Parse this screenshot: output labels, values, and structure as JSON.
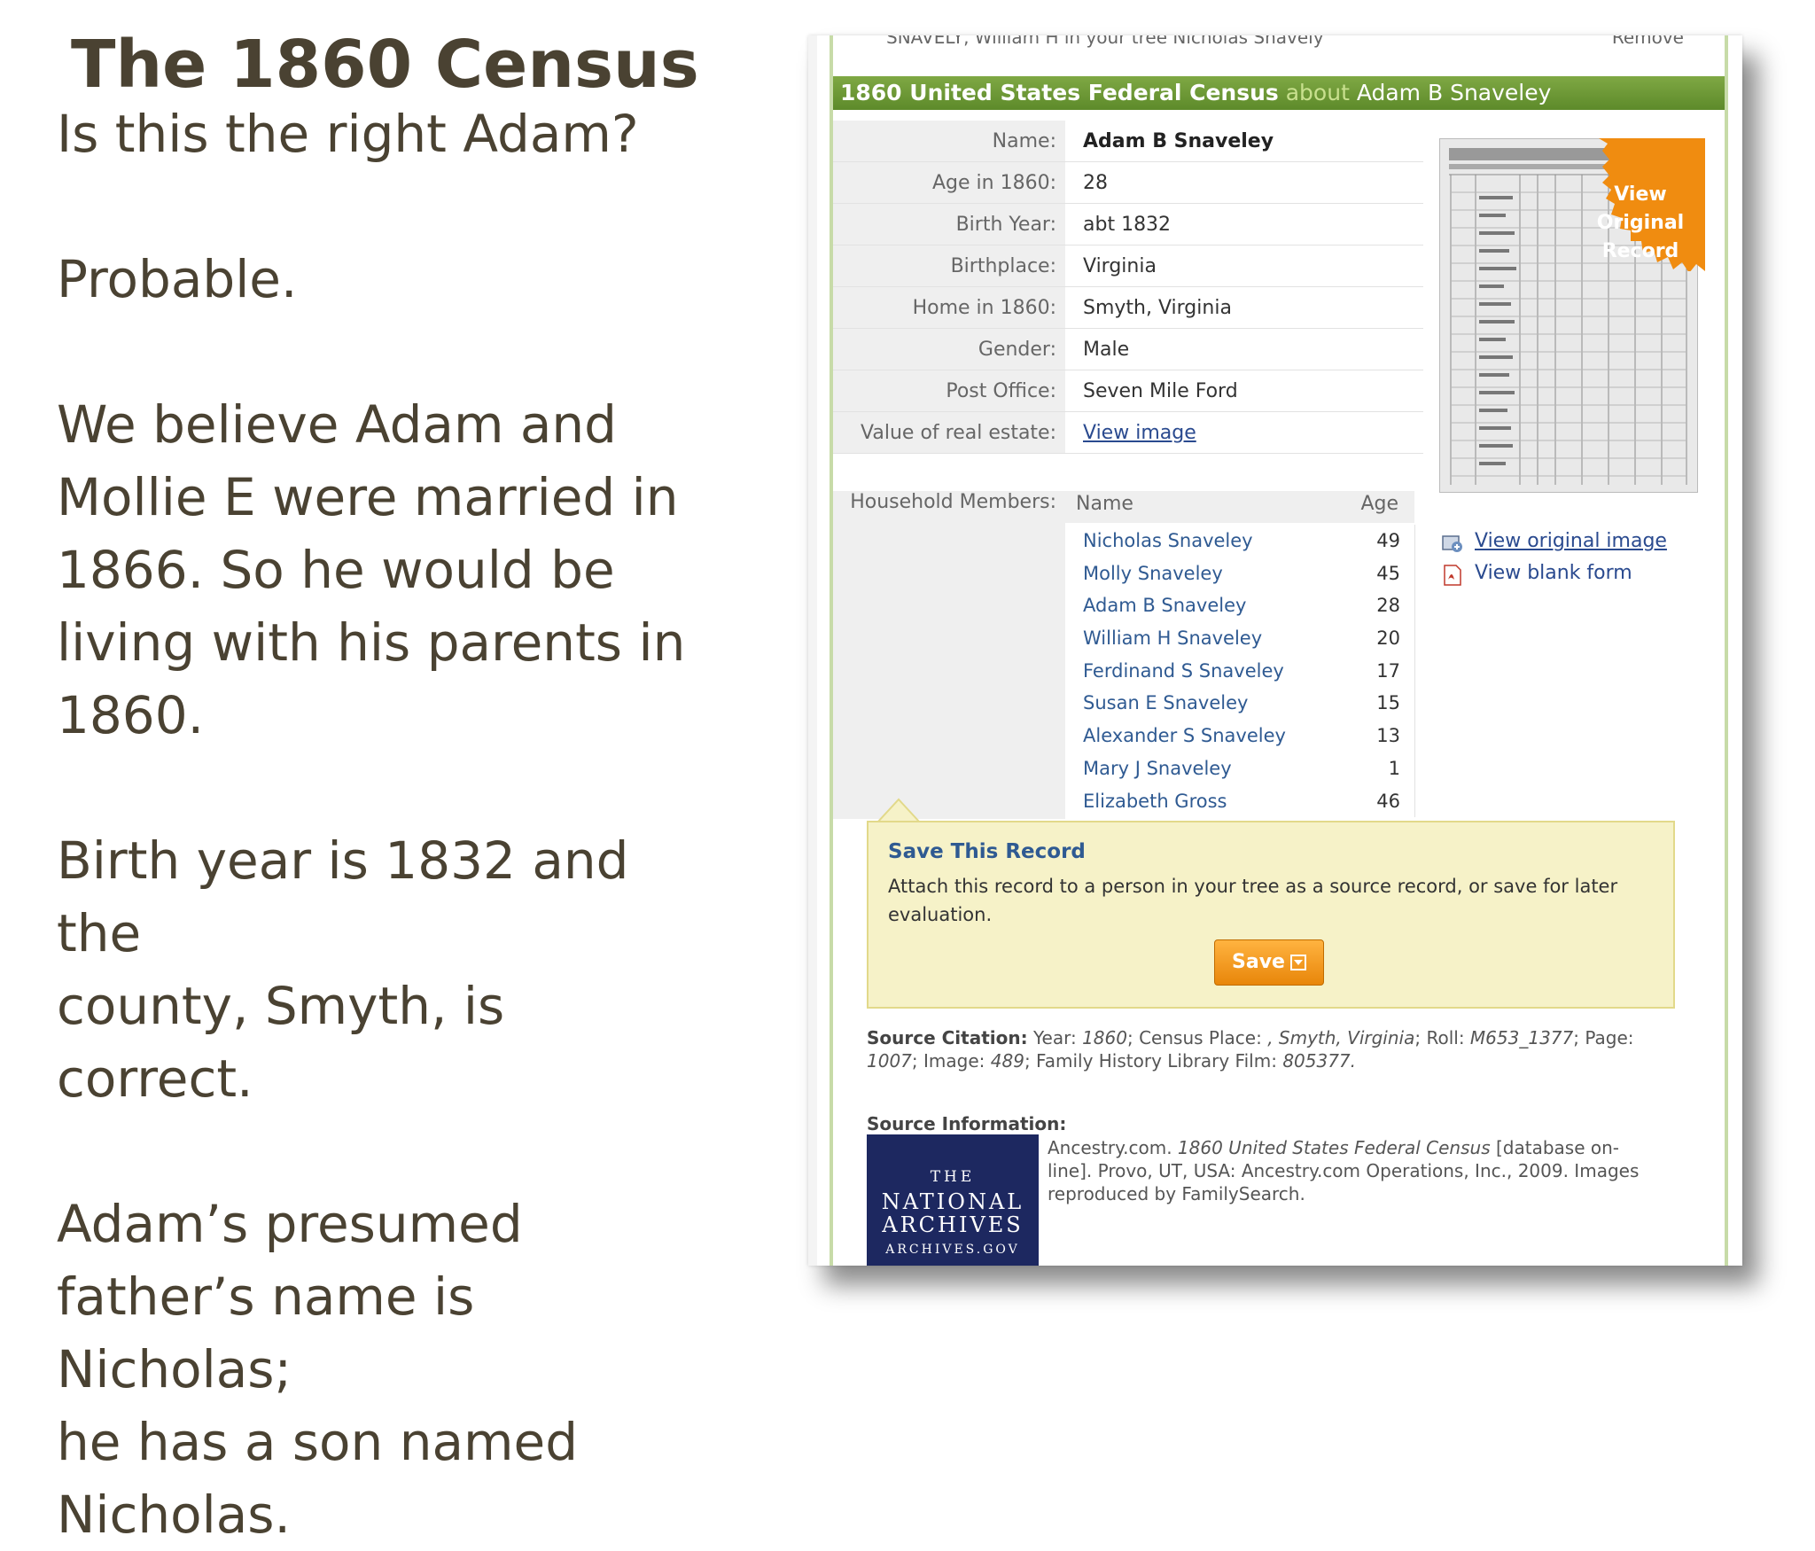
{
  "slide": {
    "title": "The 1860 Census",
    "question": "Is this the right Adam?",
    "answer": "Probable.",
    "para1": [
      "We believe Adam and",
      "Mollie E were married in",
      "1866.  So he would be",
      "living with his parents in",
      "1860."
    ],
    "para2": [
      "Birth year is 1832 and the",
      "county, Smyth, is correct."
    ],
    "para3": [
      "Adam’s presumed",
      "father’s name is Nicholas;",
      "he has a son named",
      "Nicholas."
    ]
  },
  "top_strip": {
    "text": "SNAVELY, William H in your tree   Nicholas Snavely",
    "remove": "Remove"
  },
  "record_header": {
    "title": "1860 United States Federal Census",
    "about": "about",
    "person": "Adam B Snaveley"
  },
  "fields": [
    {
      "label": "Name:",
      "value": "Adam B Snaveley"
    },
    {
      "label": "Age in 1860:",
      "value": "28"
    },
    {
      "label": "Birth Year:",
      "value": "abt 1832"
    },
    {
      "label": "Birthplace:",
      "value": "Virginia"
    },
    {
      "label": "Home in 1860:",
      "value": "Smyth, Virginia"
    },
    {
      "label": "Gender:",
      "value": "Male"
    },
    {
      "label": "Post Office:",
      "value": "Seven Mile Ford"
    },
    {
      "label": "Value of real estate:",
      "value": "View image"
    }
  ],
  "household": {
    "label": "Household Members:",
    "col_name": "Name",
    "col_age": "Age",
    "members": [
      {
        "name": "Nicholas Snaveley",
        "age": "49"
      },
      {
        "name": "Molly Snaveley",
        "age": "45"
      },
      {
        "name": "Adam B Snaveley",
        "age": "28"
      },
      {
        "name": "William H Snaveley",
        "age": "20"
      },
      {
        "name": "Ferdinand S Snaveley",
        "age": "17"
      },
      {
        "name": "Susan E Snaveley",
        "age": "15"
      },
      {
        "name": "Alexander S Snaveley",
        "age": "13"
      },
      {
        "name": "Mary J Snaveley",
        "age": "1"
      },
      {
        "name": "Elizabeth Gross",
        "age": "46"
      }
    ]
  },
  "badge": {
    "lines": [
      "View",
      "Original",
      "Record"
    ],
    "color": "#f08c10"
  },
  "links": {
    "view_original": "View original image",
    "view_blank": "View blank form"
  },
  "save": {
    "title": "Save This Record",
    "description": "Attach this record to a person in your tree as a source record, or save for later evaluation.",
    "button": "Save"
  },
  "citation": {
    "label": "Source Citation:",
    "year_label": "Year:",
    "year": "1860",
    "place_label": "Census Place:",
    "place": " , Smyth, Virginia",
    "roll_label": "Roll:",
    "roll": "M653_1377",
    "page_label": "Page:",
    "page": "1007",
    "image_label": "Image:",
    "image": "489",
    "film_label": "Family History Library Film:",
    "film": "805377."
  },
  "source_info": {
    "label": "Source Information:",
    "publisher": "Ancestry.com.",
    "db_title": "1860 United States Federal Census",
    "rest": "[database on-line]. Provo, UT, USA: Ancestry.com Operations, Inc., 2009. Images reproduced by FamilySearch."
  },
  "nara_logo": {
    "l1": "THE",
    "l2": "NATIONAL",
    "l3": "ARCHIVES",
    "l4": "ARCHIVES.GOV"
  },
  "colors": {
    "header_green": "#6a9634",
    "link_blue": "#2f5a92",
    "text_brown": "#4a4232",
    "nara_navy": "#1d2860"
  }
}
